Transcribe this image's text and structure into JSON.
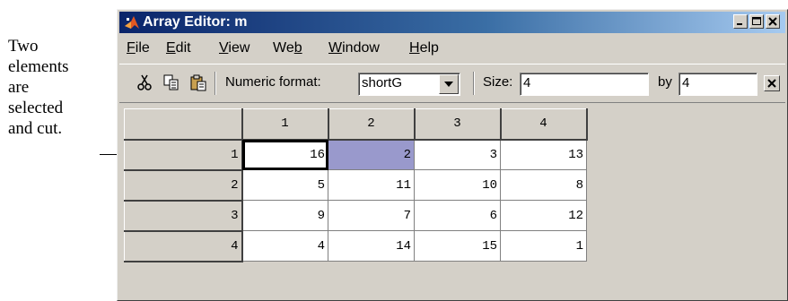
{
  "annotation": {
    "lines": [
      "Two",
      "elements",
      "are",
      "selected",
      "and cut."
    ]
  },
  "window": {
    "title": "Array Editor: m"
  },
  "menu": {
    "file": "File",
    "edit": "Edit",
    "view": "View",
    "web": "Web",
    "window": "Window",
    "help": "Help"
  },
  "toolbar": {
    "format_label": "Numeric format:",
    "format_value": "shortG",
    "size_label": "Size:",
    "rows": "4",
    "by_label": "by",
    "cols": "4"
  },
  "grid": {
    "col_headers": [
      "1",
      "2",
      "3",
      "4"
    ],
    "row_headers": [
      "1",
      "2",
      "3",
      "4"
    ],
    "rows": [
      [
        "16",
        "2",
        "3",
        "13"
      ],
      [
        "5",
        "11",
        "10",
        "8"
      ],
      [
        "9",
        "7",
        "6",
        "12"
      ],
      [
        "4",
        "14",
        "15",
        "1"
      ]
    ],
    "selection_color": "#9999cc"
  },
  "colors": {
    "titlebar_start": "#0a246a",
    "titlebar_end": "#a6caf0",
    "chrome": "#d4d0c8"
  }
}
